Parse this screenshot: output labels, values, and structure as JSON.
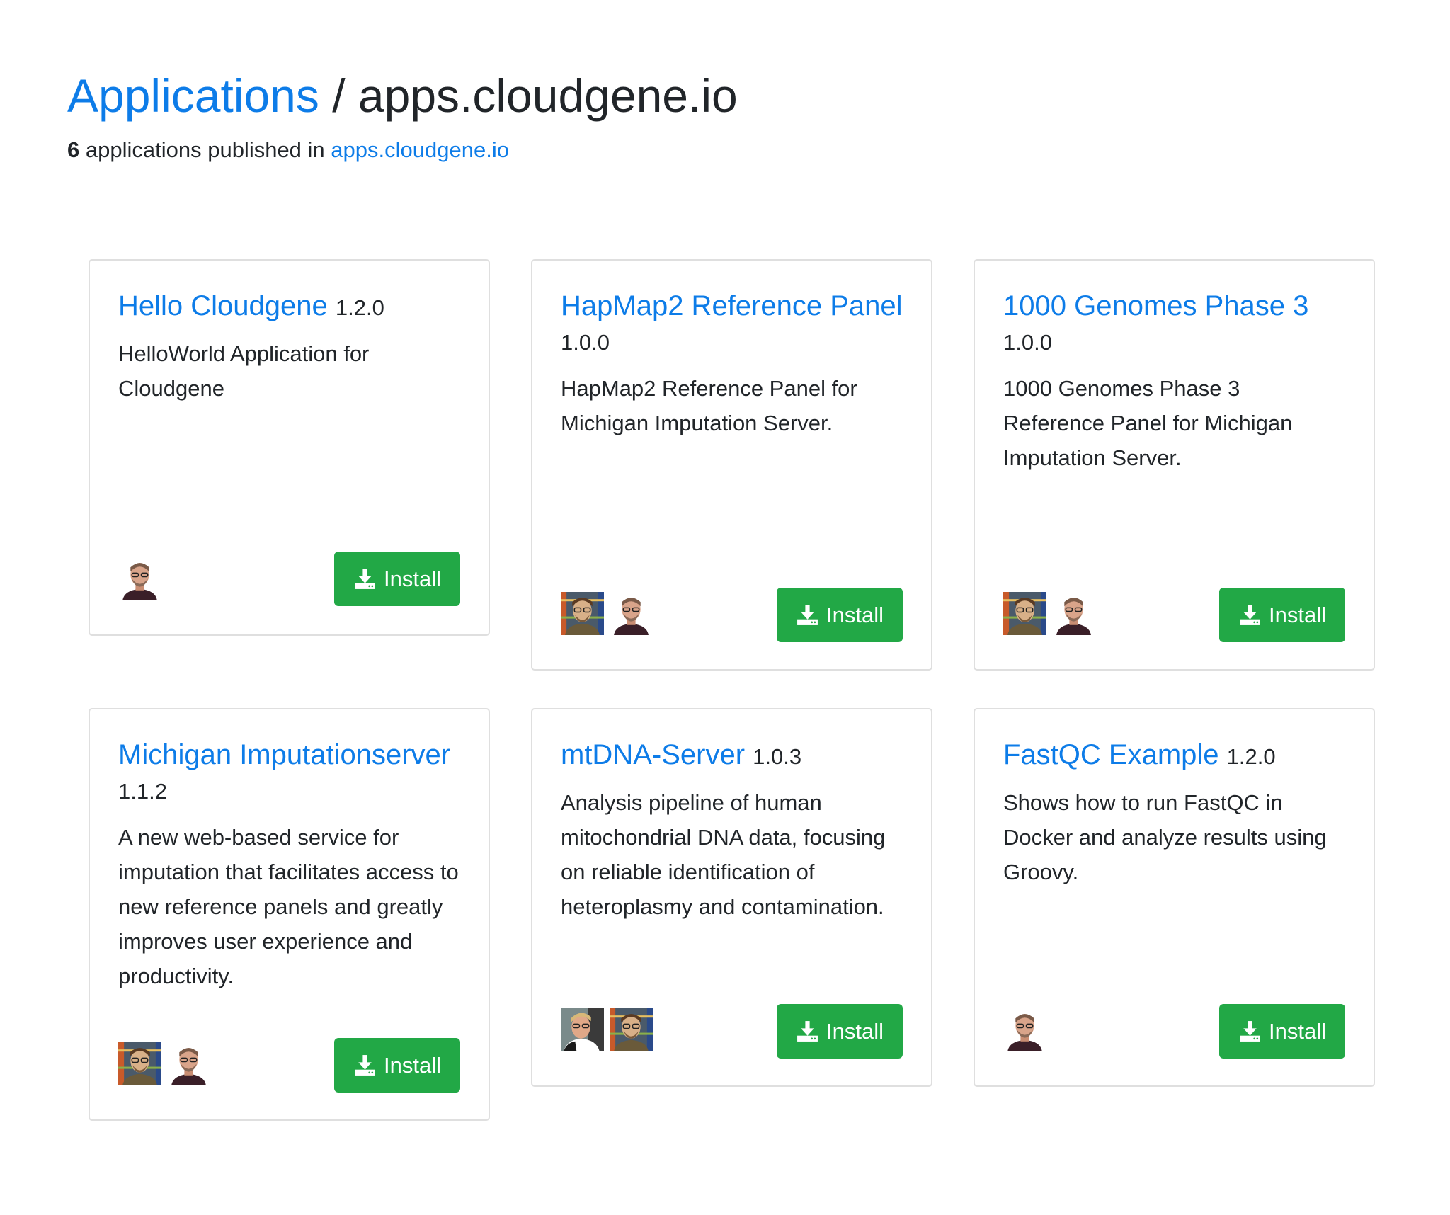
{
  "header": {
    "breadcrumb_link": "Applications",
    "separator": "/",
    "repository": "apps.cloudgene.io",
    "count": "6",
    "published_text": "applications published in",
    "repository_link": "apps.cloudgene.io"
  },
  "apps": [
    {
      "name": "Hello Cloudgene",
      "version": "1.2.0",
      "description": "HelloWorld Application for Cloudgene",
      "install_label": "Install",
      "avatars": [
        "bald-man-avatar"
      ]
    },
    {
      "name": "HapMap2 Reference Panel",
      "version": "1.0.0",
      "description": "HapMap2 Reference Panel for Michigan Imputation Server.",
      "install_label": "Install",
      "avatars": [
        "bookshelf-man-avatar",
        "bald-man-avatar"
      ]
    },
    {
      "name": "1000 Genomes Phase 3",
      "version": "1.0.0",
      "description": "1000 Genomes Phase 3 Reference Panel for Michigan Imputation Server.",
      "install_label": "Install",
      "avatars": [
        "bookshelf-man-avatar",
        "bald-man-avatar"
      ]
    },
    {
      "name": "Michigan Imputationserver",
      "version": "1.1.2",
      "description": "A new web-based service for imputation that facilitates access to new reference panels and greatly improves user experience and productivity.",
      "install_label": "Install",
      "avatars": [
        "bookshelf-man-avatar",
        "bald-man-avatar"
      ]
    },
    {
      "name": "mtDNA-Server",
      "version": "1.0.3",
      "description": "Analysis pipeline of human mitochondrial DNA data, focusing on reliable identification of heteroplasmy and contamination.",
      "install_label": "Install",
      "avatars": [
        "blond-man-avatar",
        "bookshelf-man-avatar"
      ]
    },
    {
      "name": "FastQC Example",
      "version": "1.2.0",
      "description": "Shows how to run FastQC in Docker and analyze results using Groovy.",
      "install_label": "Install",
      "avatars": [
        "bald-man-avatar"
      ]
    }
  ],
  "colors": {
    "link": "#0d7ce8",
    "install_button": "#22a846",
    "card_border": "#dfdfdf"
  }
}
